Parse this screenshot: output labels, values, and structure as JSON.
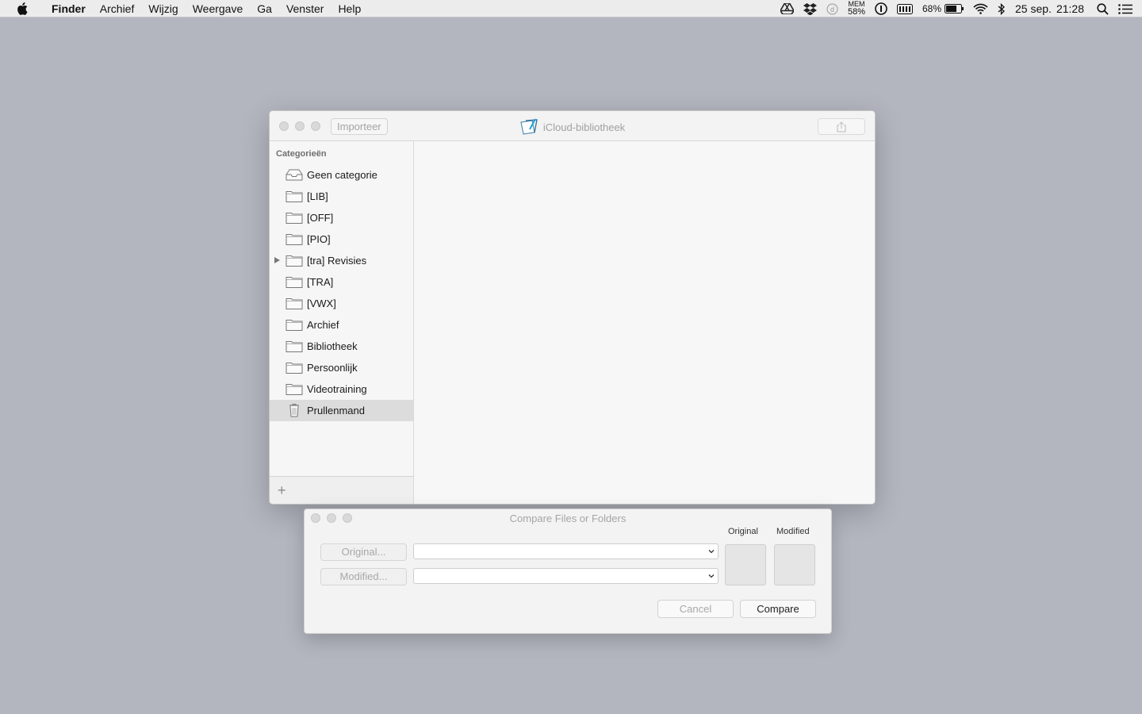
{
  "menubar": {
    "apple_icon": "apple-logo-icon",
    "items": [
      "Finder",
      "Archief",
      "Wijzig",
      "Weergave",
      "Ga",
      "Venster",
      "Help"
    ],
    "status": {
      "mem_label": "MEM",
      "mem_value": "58%",
      "battery_percent": "68%",
      "date": "25 sep.",
      "time": "21:28"
    }
  },
  "main_window": {
    "import_label": "Importeer",
    "title": "iCloud-bibliotheek",
    "sidebar_heading": "Categorieën",
    "categories": [
      {
        "label": "Geen categorie",
        "icon": "inbox-icon"
      },
      {
        "label": "[LIB]",
        "icon": "folder-icon"
      },
      {
        "label": "[OFF]",
        "icon": "folder-icon"
      },
      {
        "label": "[PIO]",
        "icon": "folder-icon"
      },
      {
        "label": "[tra] Revisies",
        "icon": "folder-icon",
        "expandable": true
      },
      {
        "label": "[TRA]",
        "icon": "folder-icon"
      },
      {
        "label": "[VWX]",
        "icon": "folder-icon"
      },
      {
        "label": "Archief",
        "icon": "folder-icon"
      },
      {
        "label": "Bibliotheek",
        "icon": "folder-icon"
      },
      {
        "label": "Persoonlijk",
        "icon": "folder-icon"
      },
      {
        "label": "Videotraining",
        "icon": "folder-icon"
      },
      {
        "label": "Prullenmand",
        "icon": "trash-icon",
        "selected": true
      }
    ],
    "add_label": "+"
  },
  "compare_window": {
    "title": "Compare Files or Folders",
    "original_col": "Original",
    "modified_col": "Modified",
    "original_button": "Original...",
    "modified_button": "Modified...",
    "original_path": "",
    "modified_path": "",
    "cancel_label": "Cancel",
    "compare_label": "Compare"
  }
}
